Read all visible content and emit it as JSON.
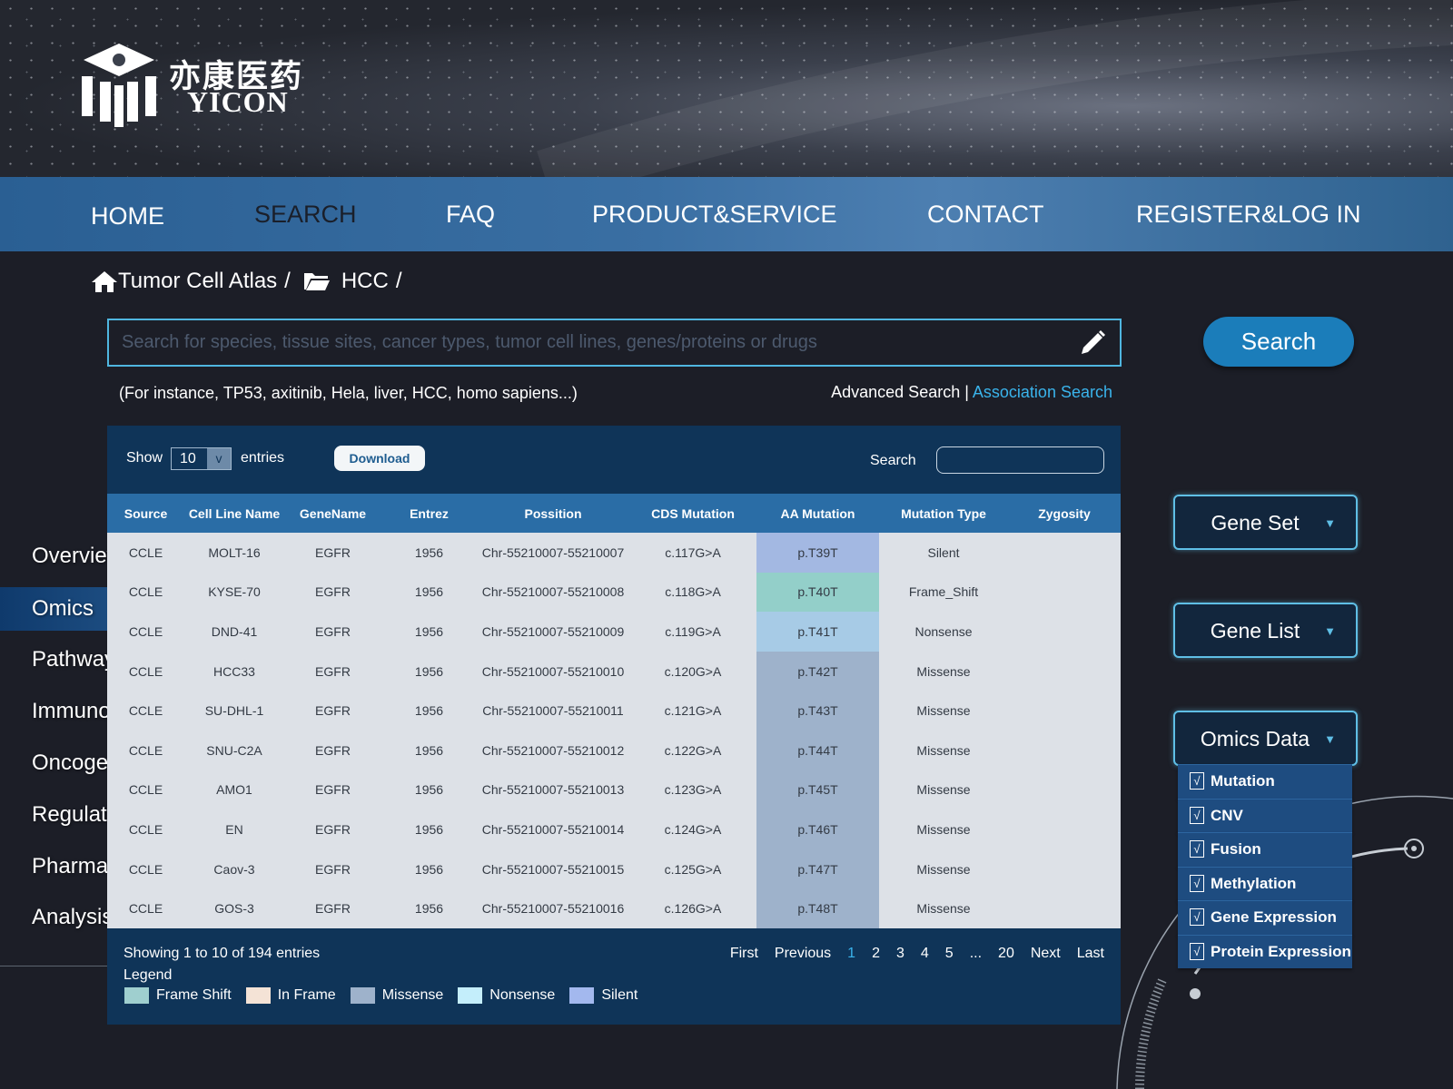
{
  "brand": {
    "cn": "亦康医药",
    "en": "YICON"
  },
  "nav": [
    "HOME",
    "SEARCH",
    "FAQ",
    "PRODUCT&SERVICE",
    "CONTACT",
    "REGISTER&LOG IN"
  ],
  "breadcrumb": {
    "root": "Tumor Cell Atlas",
    "sep1": "/",
    "child": "HCC",
    "sep2": "/"
  },
  "search": {
    "placeholder": "Search for species, tissue sites, cancer types, tumor cell lines, genes/proteins or drugs",
    "button": "Search",
    "example": "(For instance, TP53, axitinib, Hela, liver, HCC, homo sapiens...)",
    "advanced": "Advanced Search",
    "divider": " | ",
    "association": "Association Search"
  },
  "table_controls": {
    "show": "Show",
    "entries_value": "10",
    "entries_arrow": "v",
    "entries": "entries",
    "download": "Download",
    "search": "Search"
  },
  "columns": [
    "Source",
    "Cell Line Name",
    "GeneName",
    "Entrez",
    "Possition",
    "CDS Mutation",
    "AA Mutation",
    "Mutation Type",
    "Zygosity"
  ],
  "rows": [
    [
      "CCLE",
      "MOLT-16",
      "EGFR",
      "1956",
      "Chr-55210007-55210007",
      "c.117G>A",
      "p.T39T",
      "Silent",
      ""
    ],
    [
      "CCLE",
      "KYSE-70",
      "EGFR",
      "1956",
      "Chr-55210007-55210008",
      "c.118G>A",
      "p.T40T",
      "Frame_Shift",
      ""
    ],
    [
      "CCLE",
      "DND-41",
      "EGFR",
      "1956",
      "Chr-55210007-55210009",
      "c.119G>A",
      "p.T41T",
      "Nonsense",
      ""
    ],
    [
      "CCLE",
      "HCC33",
      "EGFR",
      "1956",
      "Chr-55210007-55210010",
      "c.120G>A",
      "p.T42T",
      "Missense",
      ""
    ],
    [
      "CCLE",
      "SU-DHL-1",
      "EGFR",
      "1956",
      "Chr-55210007-55210011",
      "c.121G>A",
      "p.T43T",
      "Missense",
      ""
    ],
    [
      "CCLE",
      "SNU-C2A",
      "EGFR",
      "1956",
      "Chr-55210007-55210012",
      "c.122G>A",
      "p.T44T",
      "Missense",
      ""
    ],
    [
      "CCLE",
      "AMO1",
      "EGFR",
      "1956",
      "Chr-55210007-55210013",
      "c.123G>A",
      "p.T45T",
      "Missense",
      ""
    ],
    [
      "CCLE",
      "EN",
      "EGFR",
      "1956",
      "Chr-55210007-55210014",
      "c.124G>A",
      "p.T46T",
      "Missense",
      ""
    ],
    [
      "CCLE",
      "Caov-3",
      "EGFR",
      "1956",
      "Chr-55210007-55210015",
      "c.125G>A",
      "p.T47T",
      "Missense",
      ""
    ],
    [
      "CCLE",
      "GOS-3",
      "EGFR",
      "1956",
      "Chr-55210007-55210016",
      "c.126G>A",
      "p.T48T",
      "Missense",
      ""
    ]
  ],
  "aa_colors": [
    "#a3b8e2",
    "#93cfc9",
    "#a7cbe6",
    "#9eb2cb",
    "#9eb2cb",
    "#9eb2cb",
    "#9eb2cb",
    "#9eb2cb",
    "#9eb2cb",
    "#9eb2cb"
  ],
  "footer": {
    "showing": "Showing 1 to 10 of 194 entries",
    "pager": [
      "First",
      "Previous",
      "1",
      "2",
      "3",
      "4",
      "5",
      "...",
      "20",
      "Next",
      "Last"
    ],
    "current_page": "1",
    "legend_title": "Legend",
    "legend": [
      {
        "label": "Frame Shift",
        "color": "#9fcfcf"
      },
      {
        "label": "In Frame",
        "color": "#f4e3d6"
      },
      {
        "label": "Missense",
        "color": "#9eb2cb"
      },
      {
        "label": "Nonsense",
        "color": "#c4eefb"
      },
      {
        "label": "Silent",
        "color": "#a3b8ee"
      }
    ]
  },
  "side_nav": [
    "Overview",
    "Omics",
    "Pathways",
    "Immunology",
    "Oncogenesis",
    "Regulation",
    "Pharmacology",
    "Analysis"
  ],
  "side_nav_active": "Omics",
  "filters": [
    "Gene Set",
    "Gene List",
    "Omics Data"
  ],
  "filter_arrow": "▼",
  "omics_check": "√",
  "omics_options": [
    "Mutation",
    "CNV",
    "Fusion",
    "Methylation",
    "Gene Expression",
    "Protein Expression"
  ]
}
